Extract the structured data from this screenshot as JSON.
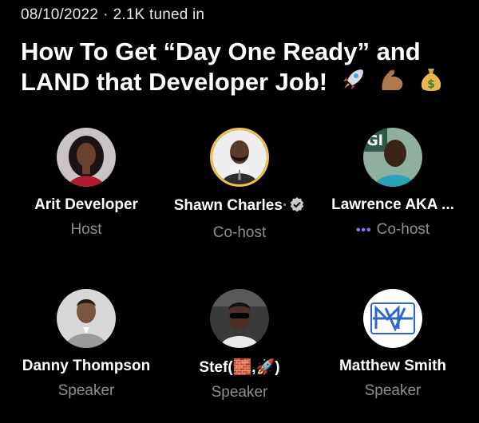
{
  "space": {
    "date": "08/10/2022",
    "separator": "·",
    "tuned_in": "2.1K tuned in",
    "title": "How To Get “Day One Ready” and LAND that Developer Job!"
  },
  "participants": [
    {
      "name": "Arit Developer",
      "role": "Host",
      "avatar": "woman-portrait"
    },
    {
      "name": "Shawn Charles",
      "role": "Co-host",
      "verified": true,
      "avatar": "man-bearded-portrait"
    },
    {
      "name": "Lawrence AKA ...",
      "role": "Co-host",
      "speaking_indicator": "•••",
      "avatar": "man-teal-shirt-portrait"
    },
    {
      "name": "Danny Thompson",
      "role": "Speaker",
      "avatar": "man-grey-suit-portrait"
    },
    {
      "name": "Stef(🧱,🚀)",
      "role": "Speaker",
      "avatar": "person-sunglasses-portrait"
    },
    {
      "name": "Matthew Smith",
      "role": "Speaker",
      "avatar": "mv-logo"
    }
  ],
  "colors": {
    "background": "#000000",
    "text": "#e7e9ea",
    "muted": "#8b8f93",
    "speaking": "#7c7cff",
    "avatar_ring": "#f0c24a"
  }
}
